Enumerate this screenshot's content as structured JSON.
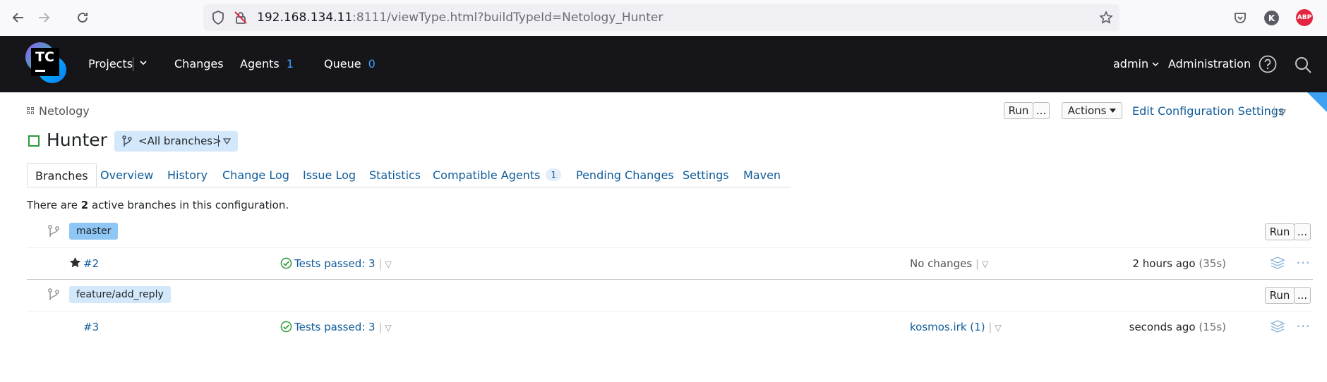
{
  "browser": {
    "url_host": "192.168.134.11",
    "url_rest": ":8111/viewType.html?buildTypeId=Netology_Hunter",
    "avatar_letter": "K",
    "adblock_label": "ABP",
    "icons": [
      "back-arrow-icon",
      "forward-arrow-icon",
      "reload-icon",
      "shield-icon",
      "no-lock-icon",
      "star-bookmark-icon",
      "pocket-icon",
      "user-account-icon",
      "adblock-icon"
    ]
  },
  "header": {
    "logo_text": "TC",
    "projects": "Projects",
    "changes": "Changes",
    "agents": "Agents",
    "agents_count": "1",
    "queue": "Queue",
    "queue_count": "0",
    "user": "admin",
    "administration": "Administration",
    "icons": [
      "help-icon",
      "search-icon"
    ]
  },
  "breadcrumb": {
    "project": "Netology"
  },
  "toolbar": {
    "run": "Run",
    "more": "...",
    "actions": "Actions",
    "edit": "Edit Configuration Settings"
  },
  "config": {
    "name": "Hunter",
    "branch_selector": "<All branches>"
  },
  "tabs": [
    {
      "label": "Branches"
    },
    {
      "label": "Overview"
    },
    {
      "label": "History"
    },
    {
      "label": "Change Log"
    },
    {
      "label": "Issue Log"
    },
    {
      "label": "Statistics"
    },
    {
      "label": "Compatible Agents",
      "badge": "1"
    },
    {
      "label": "Pending Changes"
    },
    {
      "label": "Settings"
    },
    {
      "label": "Maven"
    }
  ],
  "summary": {
    "pre": "There are ",
    "count": "2",
    "post": " active branches in this configuration."
  },
  "branches": [
    {
      "name": "master",
      "pill_color": "#8ec6f5",
      "run": "Run",
      "more": "...",
      "build": {
        "number": "#2",
        "pinned": true,
        "status": "Tests passed: 3",
        "changes": "No changes",
        "time": "2 hours ago",
        "duration": "(35s)"
      }
    },
    {
      "name": "feature/add_reply",
      "pill_color": "#d4e8fb",
      "run": "Run",
      "more": "...",
      "build": {
        "number": "#3",
        "pinned": false,
        "status": "Tests passed: 3",
        "changes": "kosmos.irk (1)",
        "time": "seconds ago",
        "duration": "(15s)"
      }
    }
  ],
  "colors": {
    "header_bg": "#16161a",
    "link": "#0f5b99",
    "success": "#2e9a3b",
    "accent": "#3fa0ff"
  }
}
